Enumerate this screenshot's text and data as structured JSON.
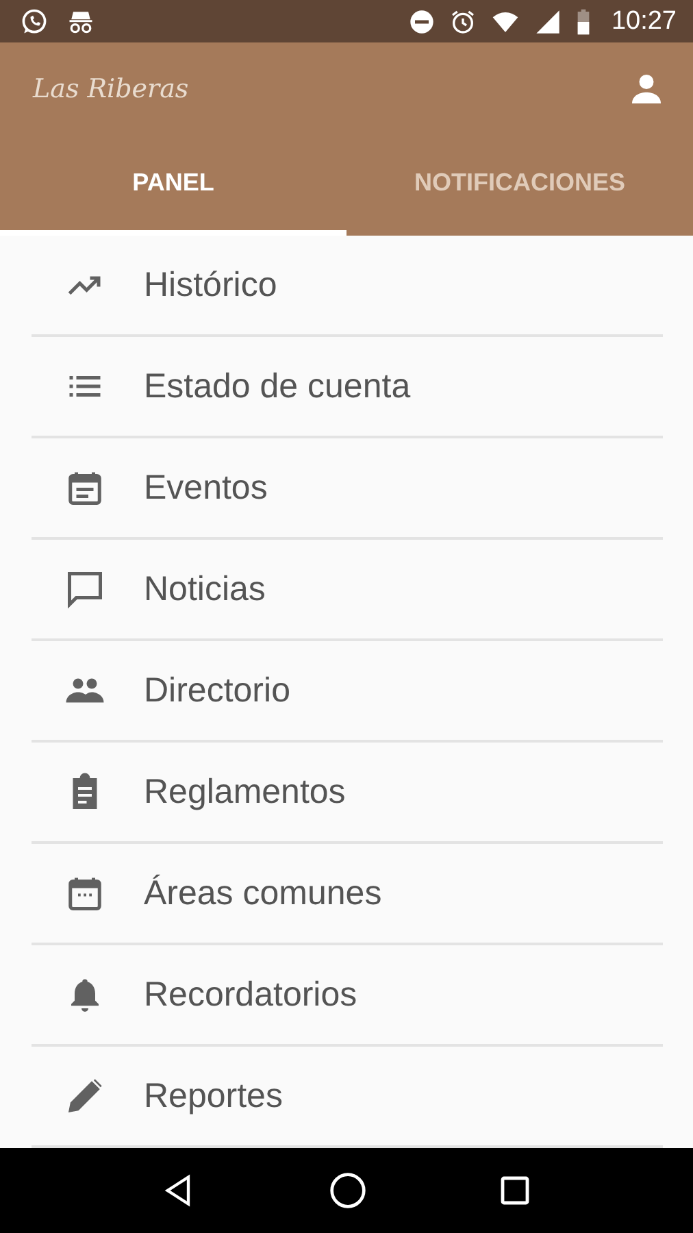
{
  "status_bar": {
    "time": "10:27"
  },
  "app_bar": {
    "logo": "Las Riberas"
  },
  "tabs": [
    {
      "label": "PANEL",
      "selected": true
    },
    {
      "label": "NOTIFICACIONES",
      "selected": false
    }
  ],
  "menu": [
    {
      "label": "Histórico"
    },
    {
      "label": "Estado de cuenta"
    },
    {
      "label": "Eventos"
    },
    {
      "label": "Noticias"
    },
    {
      "label": "Directorio"
    },
    {
      "label": "Reglamentos"
    },
    {
      "label": "Áreas comunes"
    },
    {
      "label": "Recordatorios"
    },
    {
      "label": "Reportes"
    }
  ]
}
